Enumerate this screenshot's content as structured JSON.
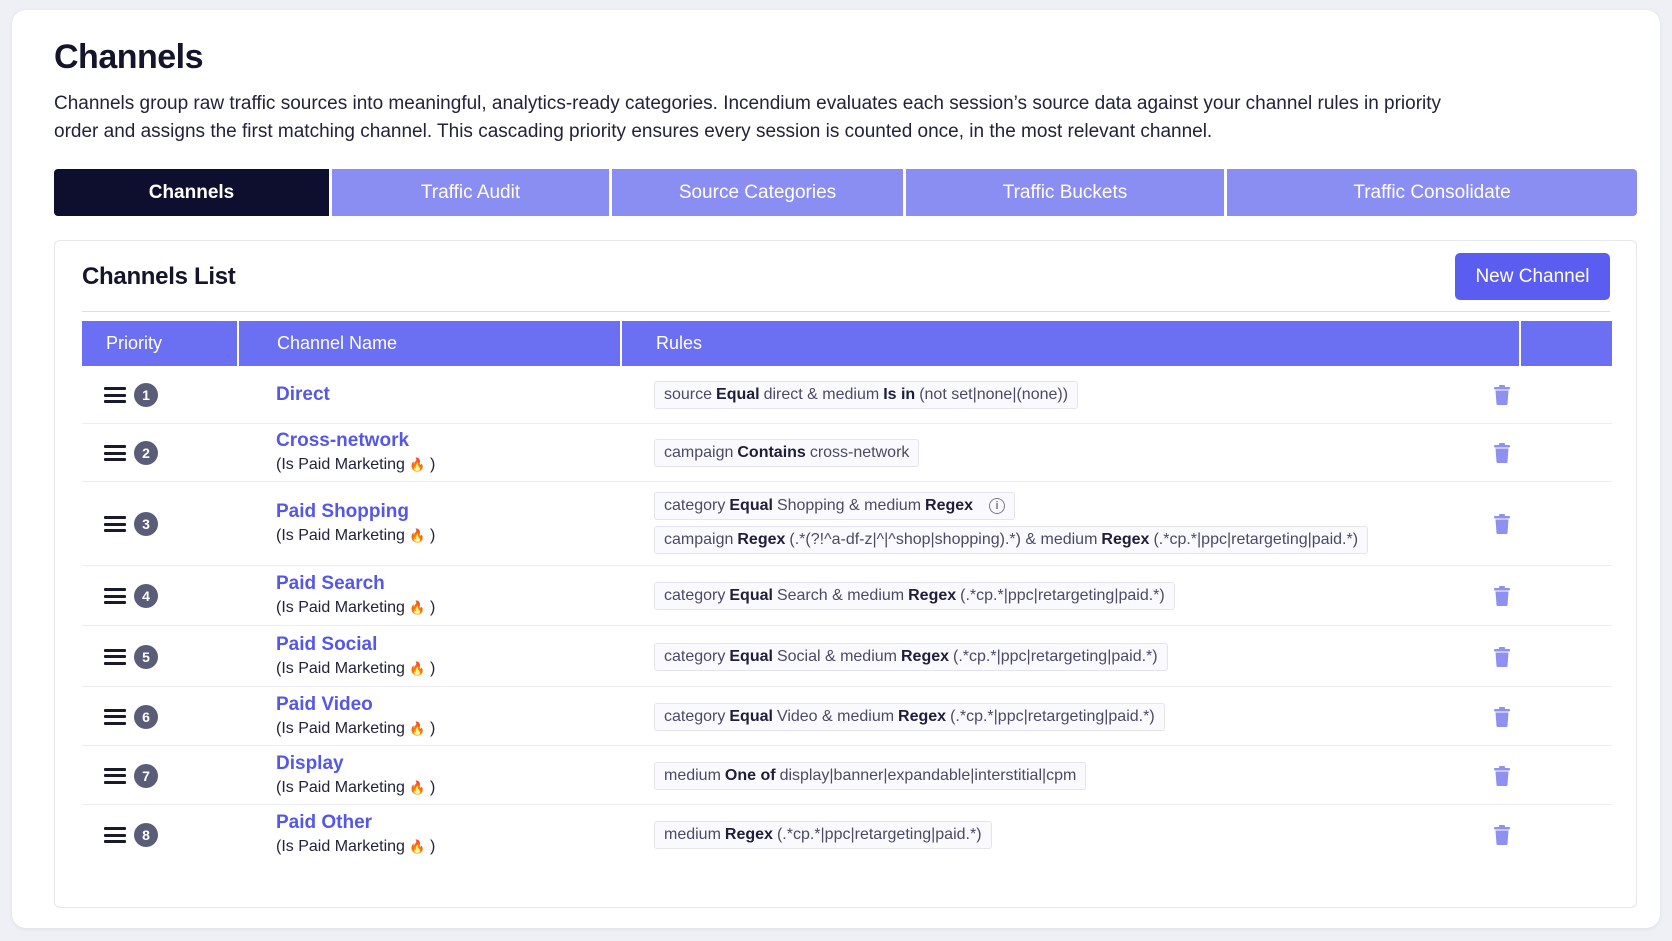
{
  "header": {
    "title": "Channels",
    "description": "Channels group raw traffic sources into meaningful, analytics-ready categories. Incendium evaluates each session’s source data against your channel rules in priority order and assigns the first matching channel. This cascading priority ensures every session is counted once, in the most relevant channel."
  },
  "tabs": [
    {
      "label": "Channels",
      "active": true
    },
    {
      "label": "Traffic Audit",
      "active": false
    },
    {
      "label": "Source Categories",
      "active": false
    },
    {
      "label": "Traffic Buckets",
      "active": false
    },
    {
      "label": "Traffic Consolidate",
      "active": false
    }
  ],
  "panel": {
    "title": "Channels List",
    "new_button": "New Channel",
    "columns": [
      "Priority",
      "Channel Name",
      "Rules",
      ""
    ]
  },
  "paid_marketing_label": "(Is Paid Marketing",
  "paid_marketing_close": ")",
  "fire_icon": "🔥",
  "colors": {
    "accent": "#5b5df0",
    "tab_inactive": "#8a8ef3",
    "tab_active": "#0e0f2e",
    "header": "#6b6ff2",
    "trash": "#8f91f2"
  },
  "rows": [
    {
      "priority": "1",
      "name": "Direct",
      "paid": false,
      "rules": [
        [
          [
            "source ",
            false
          ],
          [
            "Equal",
            true
          ],
          [
            " direct & medium ",
            false
          ],
          [
            "Is in",
            true
          ],
          [
            " (not set|none|(none))",
            false
          ]
        ]
      ]
    },
    {
      "priority": "2",
      "name": "Cross-network",
      "paid": true,
      "rules": [
        [
          [
            "campaign ",
            false
          ],
          [
            "Contains",
            true
          ],
          [
            " cross-network",
            false
          ]
        ]
      ]
    },
    {
      "priority": "3",
      "name": "Paid Shopping",
      "paid": true,
      "rules": [
        [
          [
            "category ",
            false
          ],
          [
            "Equal",
            true
          ],
          [
            " Shopping & medium ",
            false
          ],
          [
            "Regex",
            true
          ]
        ],
        [
          [
            "campaign ",
            false
          ],
          [
            "Regex",
            true
          ],
          [
            " (.*(?!^a-df-z|^|^shop|shopping).*) & medium ",
            false
          ],
          [
            "Regex",
            true
          ],
          [
            " (.*cp.*|ppc|retargeting|paid.*)",
            false
          ]
        ]
      ],
      "info_on_first_rule": true
    },
    {
      "priority": "4",
      "name": "Paid Search",
      "paid": true,
      "rules": [
        [
          [
            "category ",
            false
          ],
          [
            "Equal",
            true
          ],
          [
            " Search & medium ",
            false
          ],
          [
            "Regex",
            true
          ],
          [
            " (.*cp.*|ppc|retargeting|paid.*)",
            false
          ]
        ]
      ]
    },
    {
      "priority": "5",
      "name": "Paid Social",
      "paid": true,
      "rules": [
        [
          [
            "category ",
            false
          ],
          [
            "Equal",
            true
          ],
          [
            " Social & medium ",
            false
          ],
          [
            "Regex",
            true
          ],
          [
            " (.*cp.*|ppc|retargeting|paid.*)",
            false
          ]
        ]
      ]
    },
    {
      "priority": "6",
      "name": "Paid Video",
      "paid": true,
      "rules": [
        [
          [
            "category ",
            false
          ],
          [
            "Equal",
            true
          ],
          [
            " Video & medium ",
            false
          ],
          [
            "Regex",
            true
          ],
          [
            " (.*cp.*|ppc|retargeting|paid.*)",
            false
          ]
        ]
      ]
    },
    {
      "priority": "7",
      "name": "Display",
      "paid": true,
      "rules": [
        [
          [
            "medium ",
            false
          ],
          [
            "One of",
            true
          ],
          [
            " display|banner|expandable|interstitial|cpm",
            false
          ]
        ]
      ]
    },
    {
      "priority": "8",
      "name": "Paid Other",
      "paid": true,
      "rules": [
        [
          [
            "medium ",
            false
          ],
          [
            "Regex",
            true
          ],
          [
            " (.*cp.*|ppc|retargeting|paid.*)",
            false
          ]
        ]
      ]
    }
  ]
}
